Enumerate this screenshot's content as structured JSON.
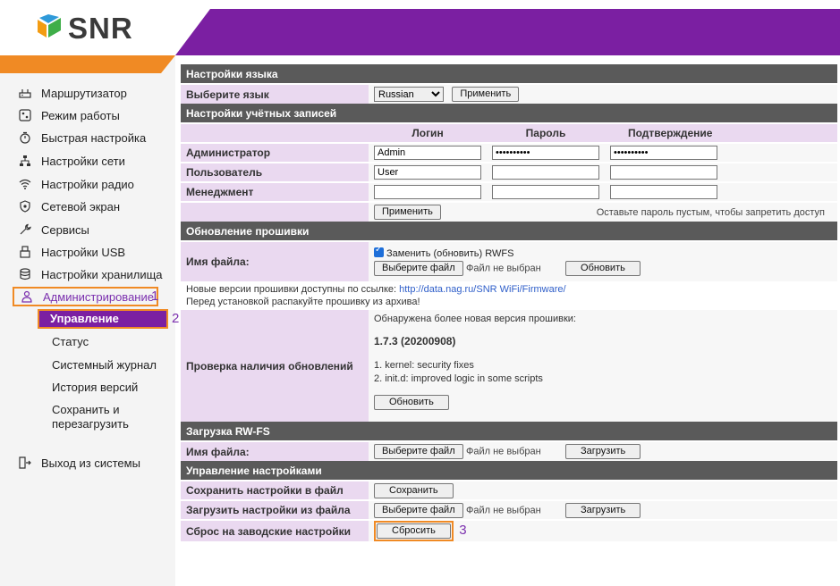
{
  "brand": {
    "logo_text": "SNR",
    "purple": "#7b1fa2",
    "orange": "#f08a24"
  },
  "sidebar": {
    "items": [
      {
        "label": "Маршрутизатор",
        "icon": "router-icon"
      },
      {
        "label": "Режим работы",
        "icon": "mode-icon"
      },
      {
        "label": "Быстрая настройка",
        "icon": "stopwatch-icon"
      },
      {
        "label": "Настройки сети",
        "icon": "network-icon"
      },
      {
        "label": "Настройки радио",
        "icon": "wifi-icon"
      },
      {
        "label": "Сетевой экран",
        "icon": "shield-icon"
      },
      {
        "label": "Сервисы",
        "icon": "wrench-icon"
      },
      {
        "label": "Настройки USB",
        "icon": "usb-icon"
      },
      {
        "label": "Настройки хранилища",
        "icon": "storage-icon"
      },
      {
        "label": "Администрирование",
        "icon": "admin-icon"
      }
    ],
    "admin_marker": "1",
    "subitems": [
      "Управление",
      "Статус",
      "Системный журнал",
      "История версий",
      "Сохранить и перезагрузить"
    ],
    "manage_marker": "2",
    "logout": {
      "label": "Выход из системы",
      "icon": "logout-icon"
    }
  },
  "lang": {
    "section": "Настройки языка",
    "label": "Выберите язык",
    "selected": "Russian",
    "apply": "Применить"
  },
  "accounts": {
    "section": "Настройки учётных записей",
    "col_login": "Логин",
    "col_password": "Пароль",
    "col_confirm": "Подтверждение",
    "rows": [
      {
        "label": "Администратор",
        "login": "Admin",
        "password": "••••••••••",
        "confirm": "••••••••••"
      },
      {
        "label": "Пользователь",
        "login": "User",
        "password": "",
        "confirm": ""
      },
      {
        "label": "Менеджмент",
        "login": "",
        "password": "",
        "confirm": ""
      }
    ],
    "apply": "Применить",
    "hint": "Оставьте пароль пустым, чтобы запретить доступ"
  },
  "firmware": {
    "section": "Обновление прошивки",
    "label": "Имя файла:",
    "replace_rwfs": "Заменить (обновить) RWFS",
    "choose_file": "Выберите файл",
    "no_file": "Файл не выбран",
    "update": "Обновить",
    "note_prefix": "Новые версии прошивки доступны по ссылке: ",
    "note_link": "http://data.nag.ru/SNR WiFi/Firmware/",
    "note_line2": "Перед установкой распакуйте прошивку из архива!",
    "check_label": "Проверка наличия обновлений",
    "found": "Обнаружена более новая версия прошивки:",
    "version": "1.7.3 (20200908)",
    "change1": "1. kernel: security fixes",
    "change2": "2. init.d: improved logic in some scripts",
    "check_update": "Обновить"
  },
  "rwfs": {
    "section": "Загрузка RW-FS",
    "label": "Имя файла:",
    "choose_file": "Выберите файл",
    "no_file": "Файл не выбран",
    "upload": "Загрузить"
  },
  "settings": {
    "section": "Управление настройками",
    "save_label": "Сохранить настройки в файл",
    "save_btn": "Сохранить",
    "load_label": "Загрузить настройки из файла",
    "choose_file": "Выберите файл",
    "no_file": "Файл не выбран",
    "load_btn": "Загрузить",
    "reset_label": "Сброс на заводские настройки",
    "reset_btn": "Сбросить",
    "reset_marker": "3"
  }
}
